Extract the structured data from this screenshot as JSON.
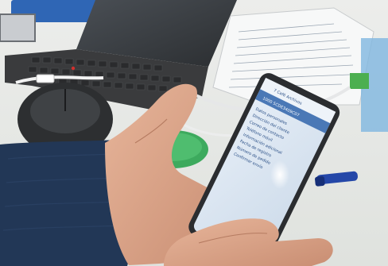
{
  "phone": {
    "toolbar_title": "7 Café Archivos",
    "header_code": "1000 5CDE3409C07",
    "body_lines": [
      "Datos personales",
      "Dirección del cliente",
      "Correo de contacto",
      "Teléfono móvil",
      "Información adicional",
      "Fecha de registro",
      "Número de pedido",
      "Confirmar envío"
    ]
  },
  "colors": {
    "phone_screen": "#dbe6f2",
    "phone_header": "#4a78b6",
    "sweater": "#223756",
    "mousepad": "#3daa5e",
    "laptop_body": "#3a3b3d",
    "pen": "#2447a8"
  }
}
